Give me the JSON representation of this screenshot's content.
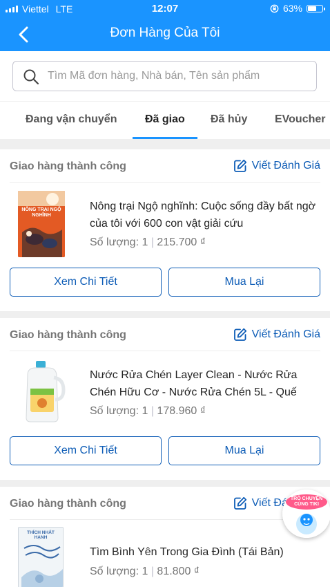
{
  "status_bar": {
    "carrier": "Viettel",
    "network": "LTE",
    "time": "12:07",
    "battery_text": "63%",
    "battery_level": 0.63
  },
  "header": {
    "title": "Đơn Hàng Của Tôi"
  },
  "search": {
    "placeholder": "Tìm Mã đơn hàng, Nhà bán, Tên sản phẩm"
  },
  "tabs": [
    {
      "label": "Đang vận chuyển"
    },
    {
      "label": "Đã giao",
      "active": true
    },
    {
      "label": "Đã hủy"
    },
    {
      "label": "EVoucher"
    }
  ],
  "orders": [
    {
      "status": "Giao hàng thành công",
      "review_label": "Viết Đánh Giá",
      "product_name": "Nông trại Ngộ nghĩnh: Cuộc sống đầy bất ngờ của tôi với 600 con vật giải cứu",
      "quantity_text": "Số lượng: 1",
      "price": "215.700 ₫",
      "thumb_caption": "NÔNG TRẠI NGỘ NGHĨNH",
      "details_label": "Xem Chi Tiết",
      "rebuy_label": "Mua Lại"
    },
    {
      "status": "Giao hàng thành công",
      "review_label": "Viết Đánh Giá",
      "product_name": "Nước Rửa Chén Layer Clean - Nước Rửa Chén Hữu Cơ - Nước Rửa Chén 5L - Quế",
      "quantity_text": "Số lượng: 1",
      "price": "178.960 ₫",
      "details_label": "Xem Chi Tiết",
      "rebuy_label": "Mua Lại"
    },
    {
      "status": "Giao hàng thành công",
      "review_label": "Viết Đánh Giá",
      "product_name": "Tìm Bình Yên Trong Gia Đình (Tái Bản)",
      "quantity_text": "Số lượng: 1",
      "price": "81.800 ₫",
      "thumb_caption": "THÍCH NHẤT HẠNH"
    }
  ],
  "chat": {
    "label_line1": "TRÒ CHUYỆN",
    "label_line2": "CÙNG TIKI"
  },
  "colors": {
    "brand_blue": "#1a94ff",
    "link_blue": "#0d5cb6"
  }
}
